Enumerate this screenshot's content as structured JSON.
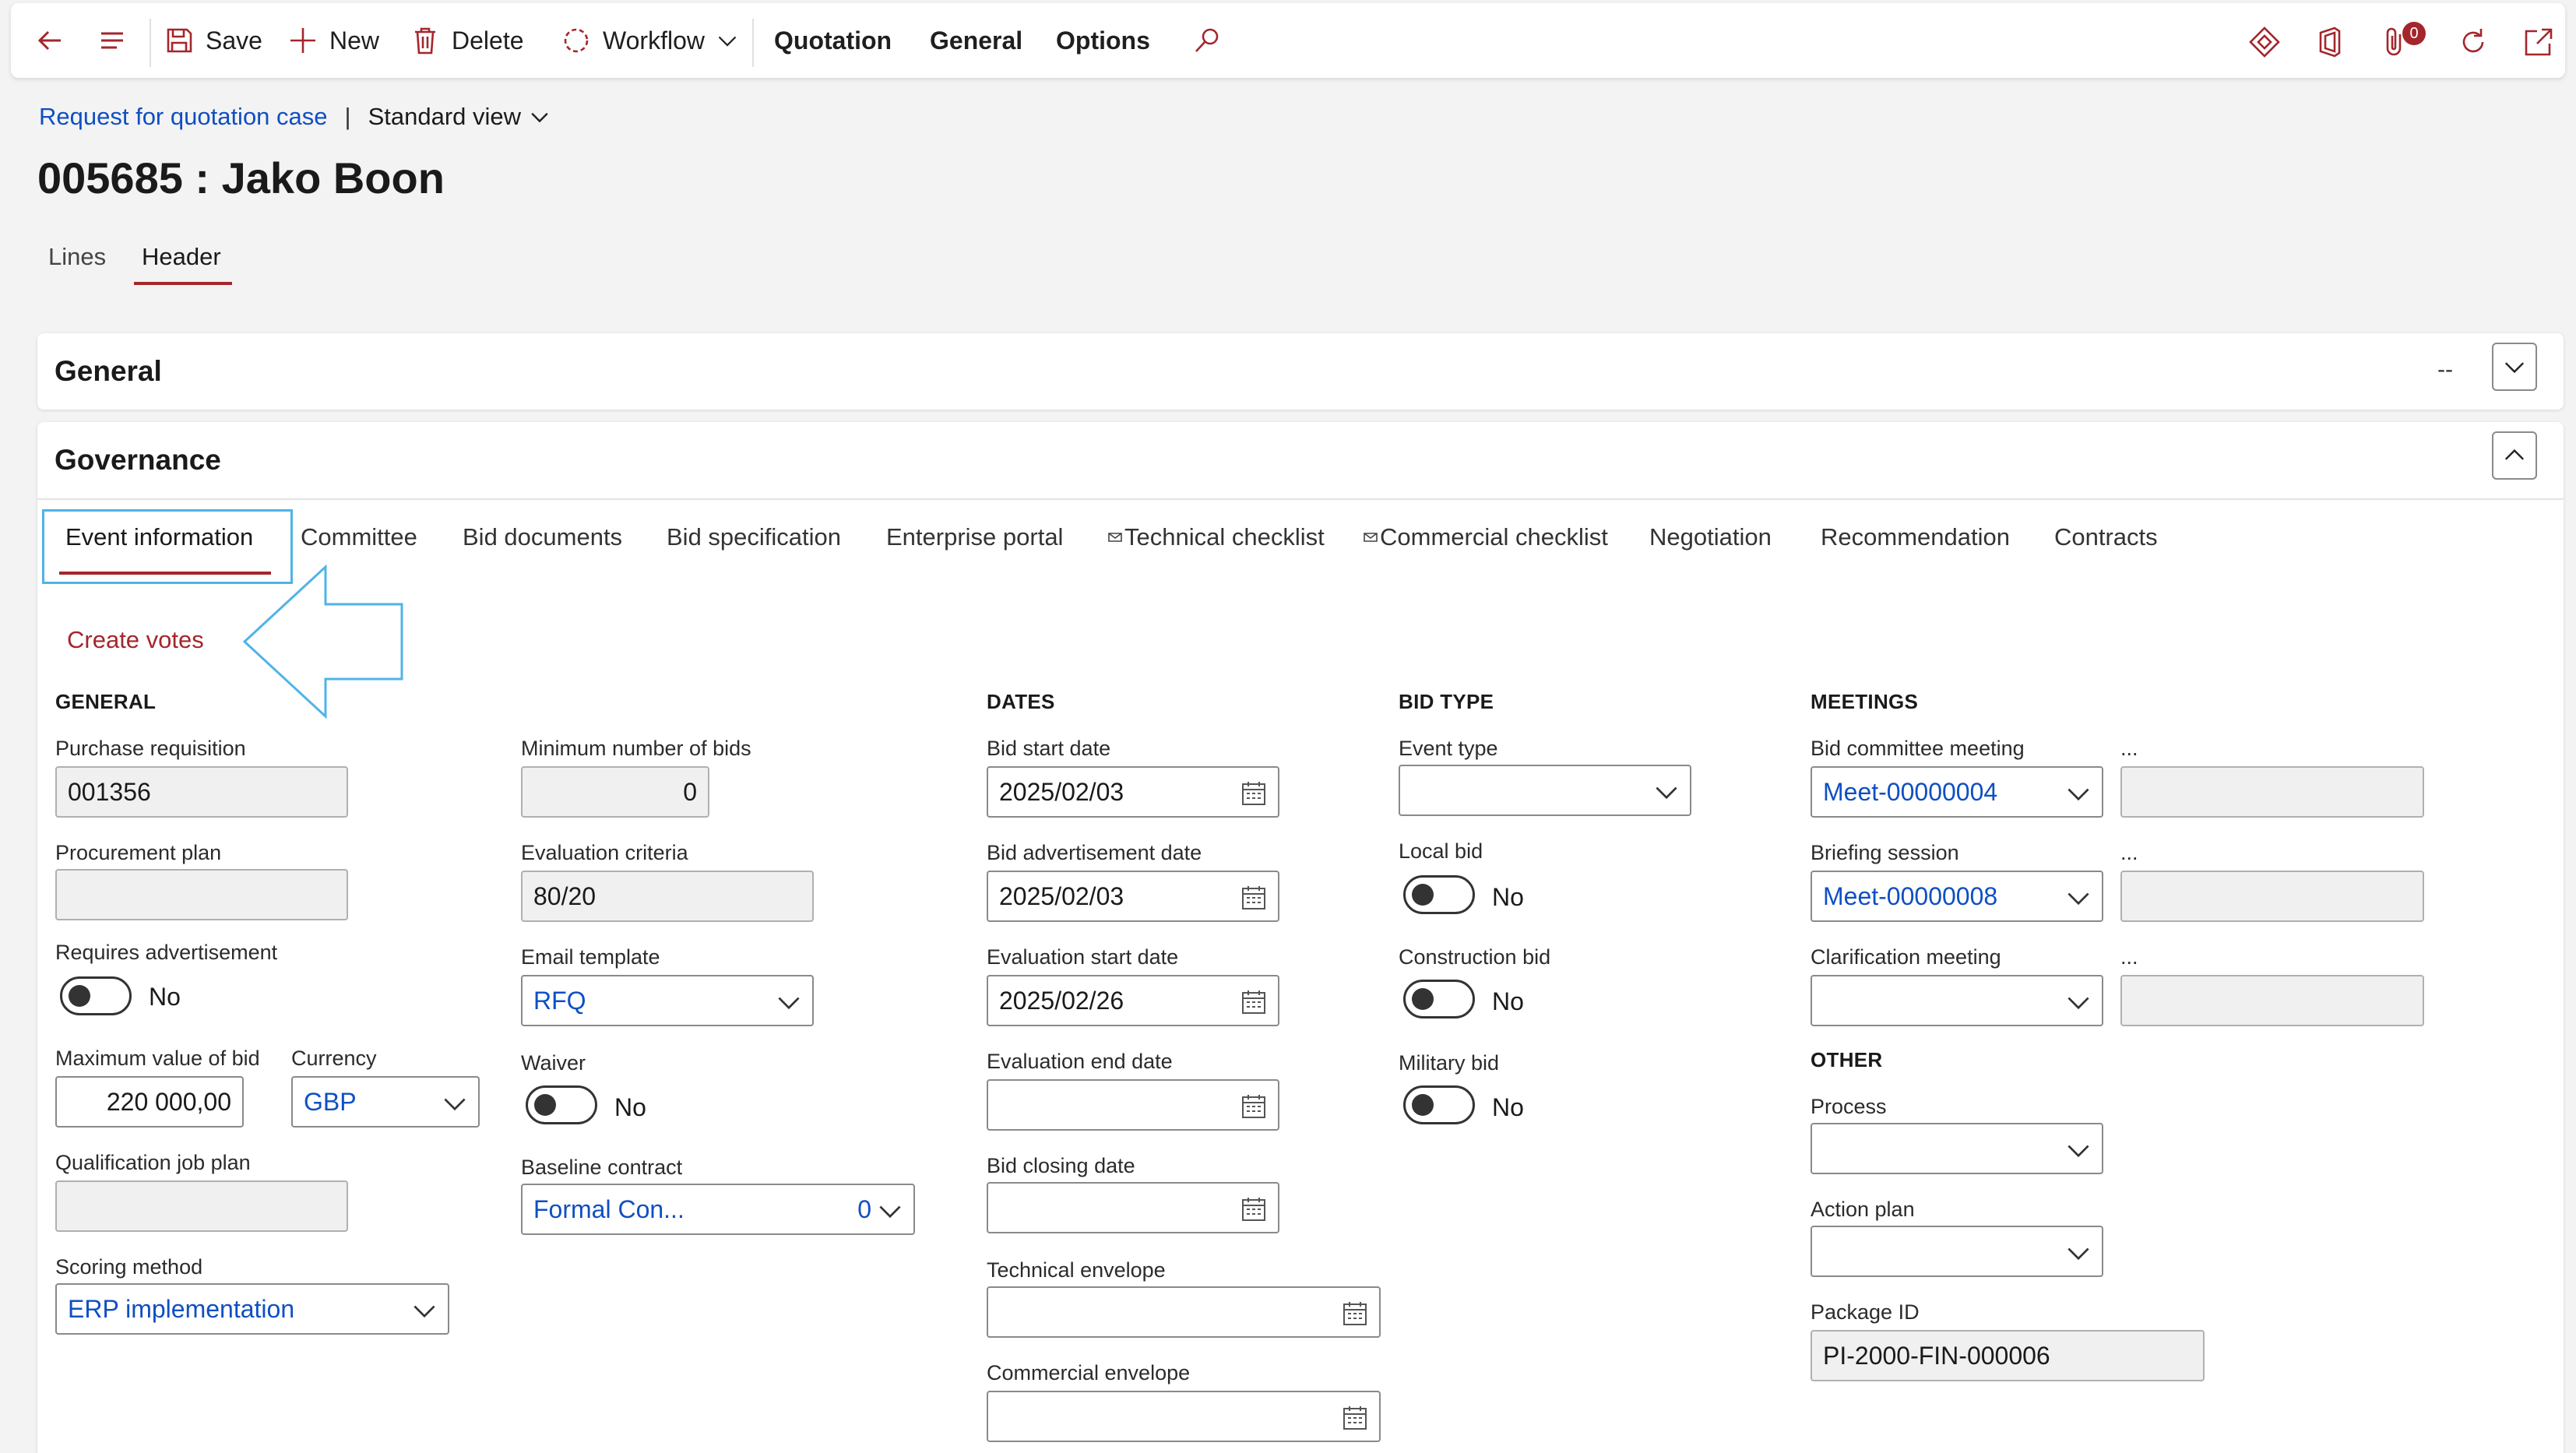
{
  "toolbar": {
    "save": "Save",
    "new": "New",
    "delete": "Delete",
    "workflow": "Workflow",
    "quotation": "Quotation",
    "general": "General",
    "options": "Options",
    "attachments_count": "0"
  },
  "breadcrumb": {
    "link": "Request for quotation case",
    "separator": "|",
    "view": "Standard view"
  },
  "page_title": "005685 : Jako Boon",
  "page_tabs": [
    "Lines",
    "Header"
  ],
  "general_section": {
    "title": "General",
    "summary": "--"
  },
  "governance": {
    "title": "Governance",
    "tabs": [
      "Event information",
      "Committee",
      "Bid documents",
      "Bid specification",
      "Enterprise portal",
      "Technical checklist",
      "Commercial checklist",
      "Negotiation",
      "Recommendation",
      "Contracts"
    ],
    "create_votes": "Create votes"
  },
  "form": {
    "general_heading": "GENERAL",
    "purchase_requisition": {
      "label": "Purchase requisition",
      "value": "001356"
    },
    "procurement_plan": {
      "label": "Procurement plan",
      "value": ""
    },
    "requires_advertisement": {
      "label": "Requires advertisement",
      "value": "No"
    },
    "maximum_value_of_bid": {
      "label": "Maximum value of bid",
      "value": "220 000,00"
    },
    "currency": {
      "label": "Currency",
      "value": "GBP"
    },
    "qualification_job_plan": {
      "label": "Qualification job plan",
      "value": ""
    },
    "scoring_method": {
      "label": "Scoring method",
      "value": "ERP implementation"
    },
    "minimum_number_of_bids": {
      "label": "Minimum number of bids",
      "value": "0"
    },
    "evaluation_criteria": {
      "label": "Evaluation criteria",
      "value": "80/20"
    },
    "email_template": {
      "label": "Email template",
      "value": "RFQ"
    },
    "waiver": {
      "label": "Waiver",
      "value": "No"
    },
    "baseline_contract": {
      "label": "Baseline contract",
      "value": "Formal Con...",
      "count": "0"
    },
    "dates_heading": "DATES",
    "bid_start_date": {
      "label": "Bid start date",
      "value": "2025/02/03"
    },
    "bid_advertisement_date": {
      "label": "Bid advertisement date",
      "value": "2025/02/03"
    },
    "evaluation_start_date": {
      "label": "Evaluation start date",
      "value": "2025/02/26"
    },
    "evaluation_end_date": {
      "label": "Evaluation end date",
      "value": ""
    },
    "bid_closing_date": {
      "label": "Bid closing date",
      "value": ""
    },
    "technical_envelope": {
      "label": "Technical envelope",
      "value": ""
    },
    "commercial_envelope": {
      "label": "Commercial envelope",
      "value": ""
    },
    "bid_type_heading": "BID TYPE",
    "event_type": {
      "label": "Event type",
      "value": ""
    },
    "local_bid": {
      "label": "Local bid",
      "value": "No"
    },
    "construction_bid": {
      "label": "Construction bid",
      "value": "No"
    },
    "military_bid": {
      "label": "Military bid",
      "value": "No"
    },
    "meetings_heading": "MEETINGS",
    "bid_committee_meeting": {
      "label": "Bid committee meeting",
      "value": "Meet-00000004",
      "extra_label": "...",
      "extra_value": ""
    },
    "briefing_session": {
      "label": "Briefing session",
      "value": "Meet-00000008",
      "extra_label": "...",
      "extra_value": ""
    },
    "clarification_meeting": {
      "label": "Clarification meeting",
      "value": "",
      "extra_label": "...",
      "extra_value": ""
    },
    "other_heading": "OTHER",
    "process": {
      "label": "Process",
      "value": ""
    },
    "action_plan": {
      "label": "Action plan",
      "value": ""
    },
    "package_id": {
      "label": "Package ID",
      "value": "PI-2000-FIN-000006"
    }
  },
  "colors": {
    "accent": "#a4262c",
    "link": "#0f4fc2",
    "annotation": "#4fb3e8"
  }
}
